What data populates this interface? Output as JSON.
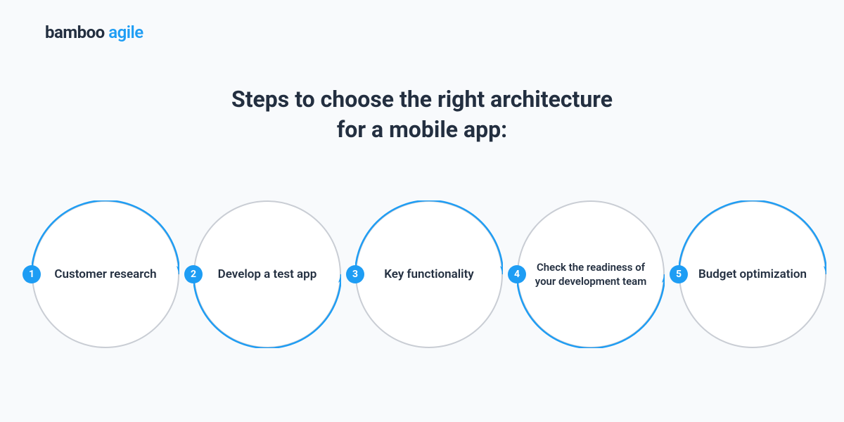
{
  "brand": {
    "word1": "bamboo",
    "word2": "agile"
  },
  "title_line1": "Steps to choose the right architecture",
  "title_line2": "for a mobile app:",
  "colors": {
    "accent": "#1e9df4",
    "dark": "#232f40",
    "grey": "#c9cdd4",
    "bg": "#f8fafc"
  },
  "steps": [
    {
      "num": "1",
      "label": "Customer research"
    },
    {
      "num": "2",
      "label": "Develop a test app"
    },
    {
      "num": "3",
      "label": "Key functionality"
    },
    {
      "num": "4",
      "label": "Check the readiness of your development team"
    },
    {
      "num": "5",
      "label": "Budget optimization"
    }
  ]
}
